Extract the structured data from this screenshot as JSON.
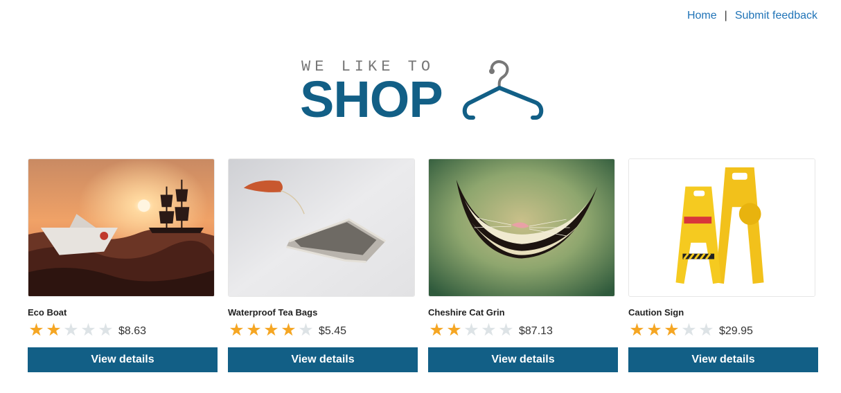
{
  "nav": {
    "home_label": "Home",
    "separator": "|",
    "feedback_label": "Submit feedback"
  },
  "logo": {
    "tagline": "WE LIKE TO",
    "word": "SHOP",
    "icon": "hanger-icon"
  },
  "colors": {
    "brand": "#125f86",
    "link": "#1f73b7",
    "star_on": "#f5a623",
    "star_off": "#dde3e6"
  },
  "products": [
    {
      "name": "Eco Boat",
      "rating": 2,
      "max_rating": 5,
      "price": "$8.63",
      "button": "View details",
      "image": "paper boat at sunset with ship"
    },
    {
      "name": "Waterproof Tea Bags",
      "rating": 4,
      "max_rating": 5,
      "price": "$5.45",
      "button": "View details",
      "image": "tea bag on white surface"
    },
    {
      "name": "Cheshire Cat Grin",
      "rating": 2,
      "max_rating": 5,
      "price": "$87.13",
      "button": "View details",
      "image": "cheshire cat grin on green"
    },
    {
      "name": "Caution Sign",
      "rating": 3,
      "max_rating": 5,
      "price": "$29.95",
      "button": "View details",
      "image": "yellow caution signs"
    }
  ]
}
